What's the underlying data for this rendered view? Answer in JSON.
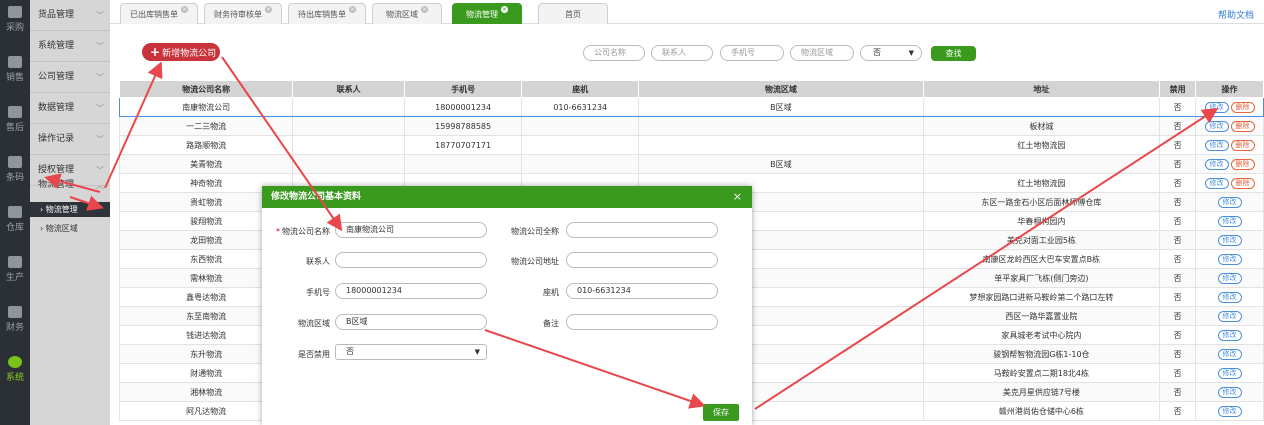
{
  "rail": [
    {
      "icon": "cart-icon",
      "label": "采购"
    },
    {
      "icon": "grid-icon",
      "label": "销售"
    },
    {
      "icon": "grid-icon",
      "label": "售后"
    },
    {
      "icon": "barcode-icon",
      "label": "条码"
    },
    {
      "icon": "warehouse-icon",
      "label": "仓库"
    },
    {
      "icon": "factory-icon",
      "label": "生产"
    },
    {
      "icon": "calculator-icon",
      "label": "财务"
    },
    {
      "icon": "gear-icon",
      "label": "系统"
    }
  ],
  "nav": {
    "items": [
      {
        "label": "货品管理"
      },
      {
        "label": "系统管理"
      },
      {
        "label": "公司管理"
      },
      {
        "label": "数据管理"
      },
      {
        "label": "操作记录"
      },
      {
        "label": "授权管理"
      },
      {
        "label": "物流管理"
      }
    ],
    "sub": [
      {
        "label": "物流管理"
      },
      {
        "label": "物流区域"
      }
    ]
  },
  "tabs": [
    {
      "label": "已出库销售单"
    },
    {
      "label": "财务待审核单"
    },
    {
      "label": "待出库销售单"
    },
    {
      "label": "物流区域"
    },
    {
      "label": "物流管理"
    },
    {
      "label": "首页"
    }
  ],
  "help": "帮助文档",
  "toolbar": {
    "add_label": "新增物流公司",
    "add_plus": "+",
    "company_ph": "公司名称",
    "contact_ph": "联系人",
    "phone_ph": "手机号",
    "area_ph": "物流区域",
    "select_value": "否",
    "search_label": "查找"
  },
  "table": {
    "headers": [
      "物流公司名称",
      "联系人",
      "手机号",
      "座机",
      "物流区域",
      "地址",
      "禁用",
      "操作"
    ],
    "edit": "修改",
    "delete": "删除",
    "rows": [
      [
        "南康物流公司",
        "",
        "18000001234",
        "010-6631234",
        "B区域",
        "",
        "否"
      ],
      [
        "一二三物流",
        "",
        "15998788585",
        "",
        "",
        "板材城",
        "否"
      ],
      [
        "路路顺物流",
        "",
        "18770707171",
        "",
        "",
        "红土地物流园",
        "否"
      ],
      [
        "美青物流",
        "",
        "",
        "",
        "B区域",
        "",
        "否"
      ],
      [
        "神奇物流",
        "",
        "",
        "",
        "",
        "红土地物流园",
        "否"
      ],
      [
        "贵虹物流",
        "",
        "",
        "",
        "",
        "东区一路金石小区后面林师傅仓库",
        "否"
      ],
      [
        "骏翔物流",
        "",
        "",
        "",
        "",
        "华春桐构园内",
        "否"
      ],
      [
        "龙田物流",
        "",
        "",
        "",
        "",
        "美克对面工业园5栋",
        "否"
      ],
      [
        "东西物流",
        "",
        "",
        "",
        "",
        "南康区龙岭西区大巴车安置点B栋",
        "否"
      ],
      [
        "需林物流",
        "",
        "",
        "",
        "",
        "单平家具厂飞栋(侧门旁边)",
        "否"
      ],
      [
        "鑫粤达物流",
        "",
        "",
        "",
        "",
        "梦想家园路口进新马鞍岭第二个路口左转",
        "否"
      ],
      [
        "东至南物流",
        "",
        "",
        "",
        "",
        "西区一路华嘉置业院",
        "否"
      ],
      [
        "钱进达物流",
        "",
        "",
        "",
        "",
        "家具城老考试中心院内",
        "否"
      ],
      [
        "东升物流",
        "",
        "",
        "",
        "",
        "骏钢帮智物流园G栋1-10仓",
        "否"
      ],
      [
        "财通物流",
        "",
        "",
        "",
        "",
        "马鞍岭安置点二期18北4栋",
        "否"
      ],
      [
        "湘林物流",
        "",
        "",
        "",
        "",
        "美克月星供应链7号楼",
        "否"
      ],
      [
        "阿凡达物流",
        "",
        "",
        "",
        "",
        "赣州港尚佑仓储中心6栋",
        "否"
      ]
    ]
  },
  "modal": {
    "title": "修改物流公司基本资料",
    "close": "×",
    "req": "*",
    "fields": {
      "name_label": "物流公司名称",
      "name_value": "南康物流公司",
      "fullname_label": "物流公司全称",
      "fullname_value": "",
      "contact_label": "联系人",
      "contact_value": "",
      "address_label": "物流公司地址",
      "address_value": "",
      "phone_label": "手机号",
      "phone_value": "18000001234",
      "landline_label": "座机",
      "landline_value": "010-6631234",
      "area_label": "物流区域",
      "area_value": "B区域",
      "note_label": "备注",
      "note_value": "",
      "disabled_label": "是否禁用",
      "disabled_value": "否"
    },
    "save": "保存"
  }
}
